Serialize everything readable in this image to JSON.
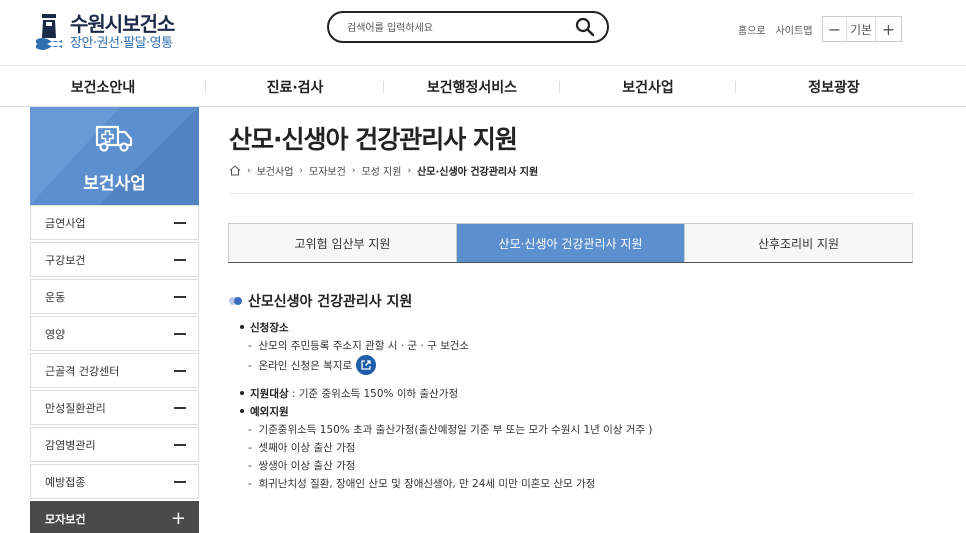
{
  "header": {
    "logo_title": "수원시보건소",
    "logo_sub": "장안·권선·팔달·영통",
    "search_placeholder": "검색어를 입력하세요",
    "util_links": [
      "홈으로",
      "사이트맵"
    ],
    "font_minus": "−",
    "font_label": "기본",
    "font_plus": "+"
  },
  "gnb": [
    "보건소안내",
    "진료·검사",
    "보건행정서비스",
    "보건사업",
    "정보광장"
  ],
  "sidebar": {
    "title": "보건사업",
    "items": [
      {
        "label": "금연사업"
      },
      {
        "label": "구강보건"
      },
      {
        "label": "운동"
      },
      {
        "label": "영양"
      },
      {
        "label": "근골격 건강센터"
      },
      {
        "label": "만성질환관리"
      },
      {
        "label": "감염병관리"
      },
      {
        "label": "예방접종"
      },
      {
        "label": "모자보건"
      }
    ]
  },
  "main": {
    "title": "산모·신생아 건강관리사 지원",
    "breadcrumb": [
      "보건사업",
      "모자보건",
      "모성 지원",
      "산모·신생아 건강관리사 지원"
    ],
    "tabs": [
      "고위험 임산부 지원",
      "산모·신생아 건강관리사 지원",
      "산후조리비 지원"
    ],
    "section_title": "산모신생아 건강관리사 지원",
    "place_label": "신청장소",
    "place_items": [
      "산모의 주민등록 주소지 관할 시 · 군 · 구 보건소",
      "온라인 신청은 복지로"
    ],
    "target_label": "지원대상",
    "target_text": ": 기준 중위소득 150% 이하 출산가정",
    "exception_label": "예외지원",
    "exception_items": [
      "기준중위소득 150% 초과 출산가정(출산예정일 기준 부 또는 모가 수원시 1년 이상 거주 )",
      "셋째아 이상 출산 가정",
      "쌍생아 이상 출산 가정",
      "희귀난치성 질환, 장애인 산모 및 장애신생아, 만 24세 미만 미혼모 산모 가정"
    ]
  },
  "colors": {
    "accent": "#5b8fce",
    "dark": "#4a4a4a",
    "link_icon": "#1f5ea8"
  }
}
